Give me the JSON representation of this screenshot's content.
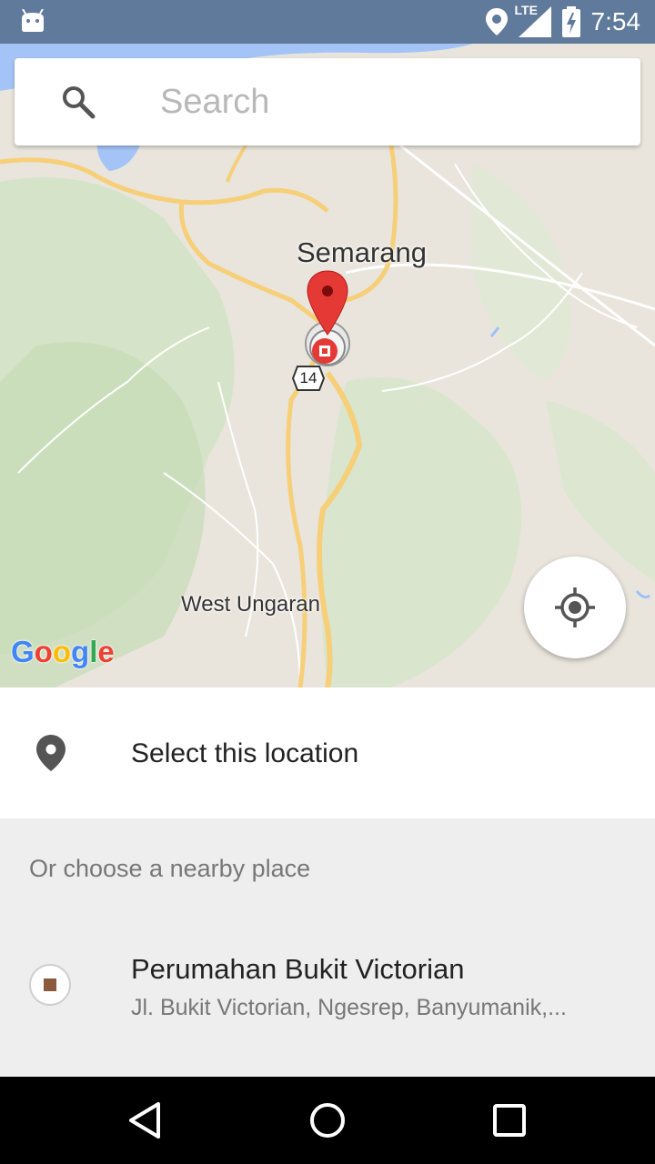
{
  "status_bar": {
    "time": "7:54",
    "network": "LTE",
    "icons": [
      "android-icon",
      "location-icon",
      "signal-icon",
      "battery-charging-icon"
    ]
  },
  "search": {
    "placeholder": "Search",
    "value": ""
  },
  "map": {
    "labels": {
      "city": "Semarang",
      "town": "West Ungaran",
      "road_shield": "14"
    },
    "attribution": [
      "G",
      "o",
      "o",
      "g",
      "l",
      "e"
    ],
    "attribution_colors": [
      "#4285F4",
      "#EA4335",
      "#FBBC05",
      "#4285F4",
      "#34A853",
      "#EA4335"
    ],
    "marker_color": "#e53935",
    "my_location_icon": "my-location-icon"
  },
  "select_location": {
    "label": "Select this location",
    "icon": "place-pin-icon"
  },
  "nearby": {
    "header": "Or choose a nearby place",
    "places": [
      {
        "name": "Perumahan Bukit Victorian",
        "address": "Jl. Bukit Victorian, Ngesrep, Banyumanik,...",
        "icon_color": "#8b5a3c"
      }
    ]
  },
  "nav_bar": {
    "buttons": [
      "back-icon",
      "home-icon",
      "recents-icon"
    ]
  }
}
